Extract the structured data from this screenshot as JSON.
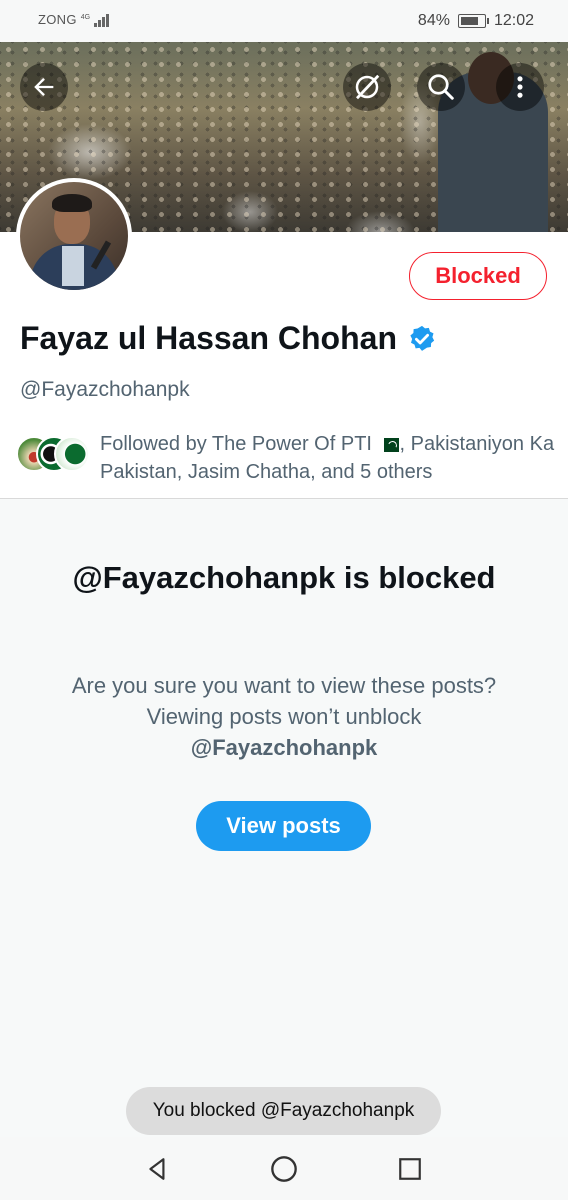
{
  "status_bar": {
    "carrier": "ZONG",
    "network": "4G",
    "battery": "84%",
    "battery_level": 0.84,
    "time": "12:02"
  },
  "header": {
    "back_icon": "back-arrow-icon",
    "grok_icon": "grok-icon",
    "search_icon": "search-icon",
    "more_icon": "more-vertical-icon"
  },
  "profile": {
    "name": "Fayaz ul Hassan Chohan",
    "verified": true,
    "verified_color": "#1d9bf0",
    "handle": "@Fayazchohanpk",
    "blocked_button_label": "Blocked",
    "blocked_color": "#f4212e",
    "followed_by_text_before_flag": "Followed by The Power Of PTI ",
    "followed_by_text_after_flag": ", Pakistaniyon Ka Pakistan, Jasim Chatha, and 5 others"
  },
  "blocked_notice": {
    "title": "@Fayazchohanpk is blocked",
    "description": "Are you sure you want to view these posts? Viewing posts won’t unblock ",
    "description_handle": "@Fayazchohanpk",
    "view_button_label": "View posts",
    "accent_color": "#1d9bf0"
  },
  "toast": {
    "text": "You blocked @Fayazchohanpk"
  },
  "nav_bar": {
    "back_icon": "triangle-back-icon",
    "home_icon": "circle-home-icon",
    "recents_icon": "square-recents-icon"
  }
}
